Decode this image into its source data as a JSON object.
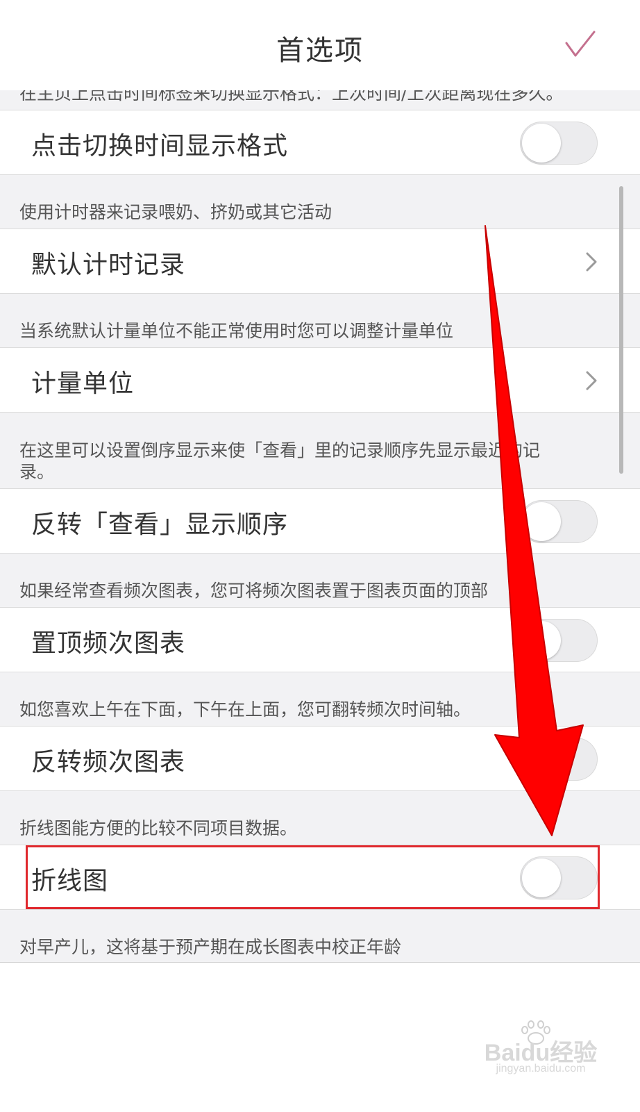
{
  "header": {
    "title": "首选项",
    "confirm_icon": "checkmark-icon",
    "accent_color": "#c4708e"
  },
  "sections": [
    {
      "desc": "在主页上点击时间标签来切换显示格式：上次时间/上次距离现在多久。",
      "label": "点击切换时间显示格式",
      "control": "toggle",
      "state": "off"
    },
    {
      "desc": "使用计时器来记录喂奶、挤奶或其它活动",
      "label": "默认计时记录",
      "control": "chevron"
    },
    {
      "desc": "当系统默认计量单位不能正常使用时您可以调整计量单位",
      "label": "计量单位",
      "control": "chevron"
    },
    {
      "desc": "在这里可以设置倒序显示来使「查看」里的记录顺序先显示最近的记录。",
      "label": "反转「查看」显示顺序",
      "control": "toggle",
      "state": "off"
    },
    {
      "desc": "如果经常查看频次图表，您可将频次图表置于图表页面的顶部",
      "label": "置顶频次图表",
      "control": "toggle",
      "state": "off"
    },
    {
      "desc": "如您喜欢上午在下面，下午在上面，您可翻转频次时间轴。",
      "label": "反转频次图表",
      "control": "toggle",
      "state": "off"
    },
    {
      "desc": "折线图能方便的比较不同项目数据。",
      "label": "折线图",
      "control": "toggle",
      "state": "off"
    }
  ],
  "trailing_desc": "对早产儿，这将基于预产期在成长图表中校正年龄",
  "annotation": {
    "arrow_color": "#ff0000",
    "highlight_color": "#e0282d"
  },
  "watermark": {
    "logo": "Baidu经验",
    "url": "jingyan.baidu.com"
  }
}
